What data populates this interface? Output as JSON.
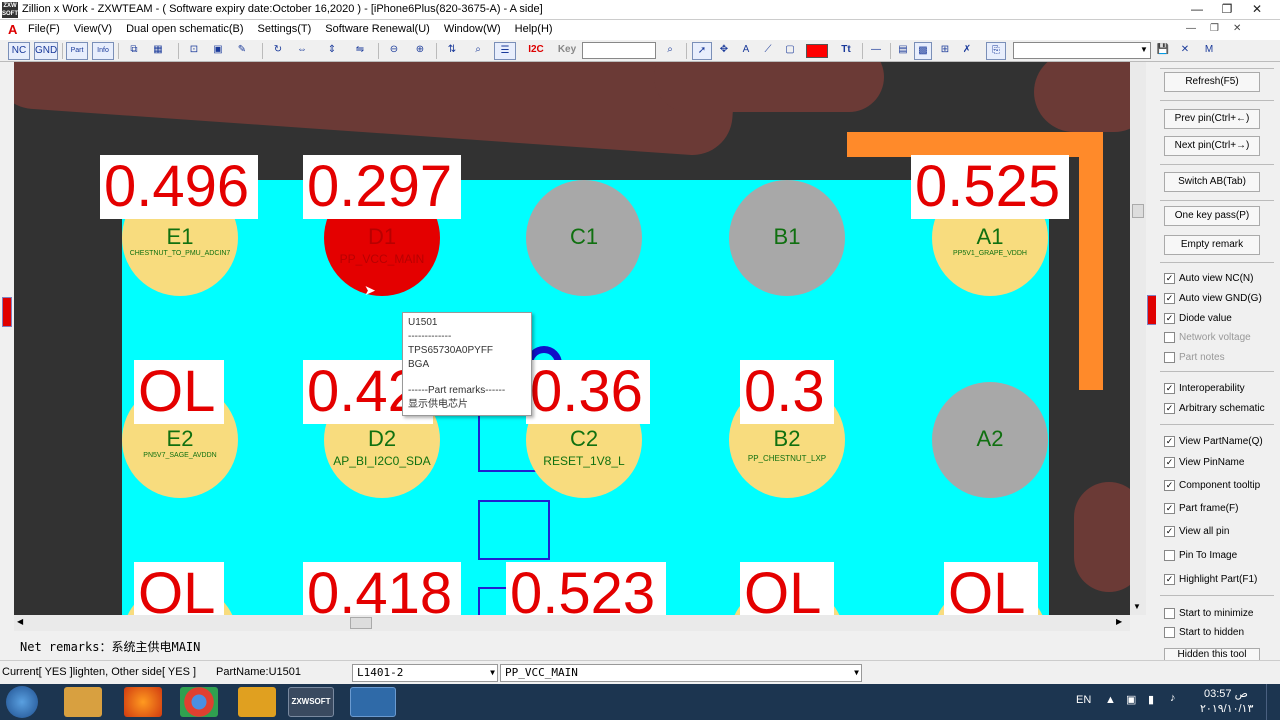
{
  "window": {
    "title": "Zillion x Work - ZXWTEAM - ( Software expiry date:October 16,2020 ) - [iPhone6Plus(820-3675-A) - A side]",
    "app_icon_text": "ZXW SOFT",
    "min": "—",
    "max": "❐",
    "close": "✕"
  },
  "menu": [
    "File(F)",
    "View(V)",
    "Dual open schematic(B)",
    "Settings(T)",
    "Software Renewal(U)",
    "Window(W)",
    "Help(H)"
  ],
  "menu_logo": "A",
  "toolbar": {
    "nc": "NC",
    "gnd": "GND",
    "part": "Part",
    "info": "Info",
    "i2c": "I2C",
    "key": "Key",
    "key_value": "",
    "search_value": ""
  },
  "tooltip": {
    "part": "U1501",
    "dashes": "-------------",
    "model": "TPS65730A0PYFF",
    "package": "BGA",
    "remarks_header": "------Part remarks------",
    "remark": "显示供电芯片"
  },
  "pads": {
    "E1": {
      "name": "E1",
      "net": "CHESTNUT_TO_PMU_ADCIN7",
      "value": "0.496"
    },
    "D1": {
      "name": "D1",
      "net": "PP_VCC_MAIN",
      "value": "0.297"
    },
    "C1": {
      "name": "C1"
    },
    "B1": {
      "name": "B1"
    },
    "A1": {
      "name": "A1",
      "net": "PP5V1_GRAPE_VDDH",
      "value": "0.525"
    },
    "E2": {
      "name": "E2",
      "net": "PN5V7_SAGE_AVDDN",
      "value": "OL"
    },
    "D2": {
      "name": "D2",
      "net": "AP_BI_I2C0_SDA",
      "value": "0.42"
    },
    "C2": {
      "name": "C2",
      "net": "RESET_1V8_L",
      "value": "0.36"
    },
    "B2": {
      "name": "B2",
      "net": "PP_CHESTNUT_LXP",
      "value": "0.3"
    },
    "A2": {
      "name": "A2"
    },
    "E3": {
      "value": "OL"
    },
    "D3": {
      "value": "0.418"
    },
    "C3": {
      "value": "0.523"
    },
    "B3": {
      "value": "OL"
    },
    "A3": {
      "value": "OL"
    }
  },
  "right_panel": {
    "refresh": "Refresh(F5)",
    "prev_pin": "Prev pin(Ctrl+←)",
    "next_pin": "Next pin(Ctrl+→)",
    "switch_ab": "Switch AB(Tab)",
    "one_key_pass": "One key pass(P)",
    "empty_remark": "Empty remark",
    "checks": [
      {
        "label": "Auto view NC(N)",
        "checked": "✓"
      },
      {
        "label": "Auto view GND(G)",
        "checked": "✓"
      },
      {
        "label": "Diode value",
        "checked": "✓"
      },
      {
        "label": "Network voltage",
        "checked": ""
      },
      {
        "label": "Part notes",
        "checked": ""
      },
      {
        "label": "Interoperability",
        "checked": "✓"
      },
      {
        "label": "Arbitrary schematic",
        "checked": "✓"
      },
      {
        "label": "View PartName(Q)",
        "checked": "✓"
      },
      {
        "label": "View PinName",
        "checked": "✓"
      },
      {
        "label": "Component tooltip",
        "checked": "✓"
      },
      {
        "label": "Part frame(F)",
        "checked": "✓"
      },
      {
        "label": "View all pin",
        "checked": "✓"
      },
      {
        "label": "Pin To Image",
        "checked": ""
      },
      {
        "label": "Highlight Part(F1)",
        "checked": "✓"
      },
      {
        "label": "Start to minimize",
        "checked": ""
      },
      {
        "label": "Start to hidden",
        "checked": ""
      }
    ],
    "hidden_tool": "Hidden this tool"
  },
  "net_remarks": "Net remarks：系统主供电MAIN",
  "status": {
    "current": "Current[ YES ]lighten,  Other side[ YES ]",
    "part_name": "PartName:U1501",
    "pin": "L1401-2",
    "net": "PP_VCC_MAIN"
  },
  "taskbar": {
    "lang": "EN",
    "time": "03:57 ص",
    "date": "٢٠١٩/١٠/١٣",
    "zxw_label": "ZXWSOFT"
  }
}
